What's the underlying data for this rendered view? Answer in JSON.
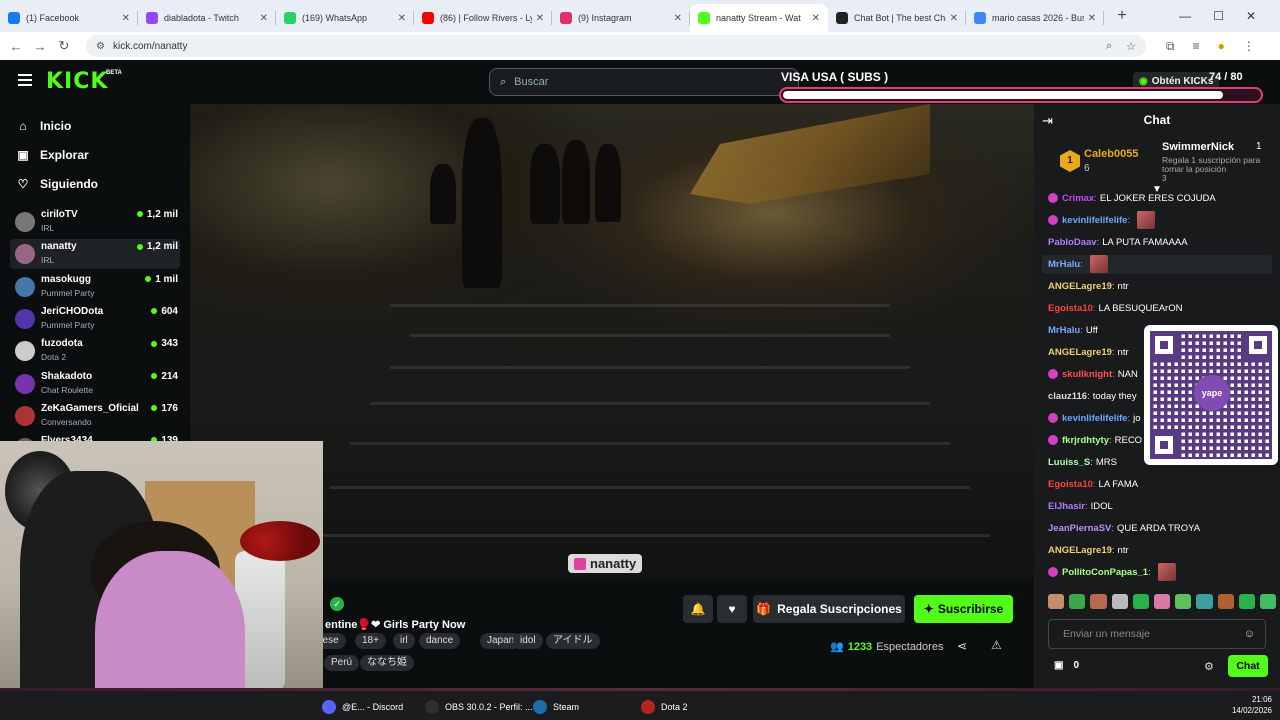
{
  "browser": {
    "tabs": [
      {
        "title": "(1) Facebook",
        "color": "#1877f2"
      },
      {
        "title": "diabladota - Twitch",
        "color": "#9146ff"
      },
      {
        "title": "(169) WhatsApp",
        "color": "#25d366"
      },
      {
        "title": "(86) | Follow Rivers - Lykk",
        "color": "#ff0000"
      },
      {
        "title": "(9) Instagram",
        "color": "#e1306c"
      },
      {
        "title": "nanatty Stream - Wat",
        "color": "#53fc18",
        "active": true
      },
      {
        "title": "Chat Bot | The best ChatB",
        "color": "#222222"
      },
      {
        "title": "mario casas 2026 - Busca",
        "color": "#4285f4"
      }
    ],
    "url": "kick.com/nanatty"
  },
  "header": {
    "logo": "KICK",
    "beta": "BETA",
    "search_placeholder": "Buscar",
    "kicks_label": "Obtén KICKs"
  },
  "overlay": {
    "title": "VISA USA ( SUBS )",
    "count": "74 / 80",
    "progress": 0.925
  },
  "sidebar": {
    "nav": [
      {
        "label": "Inicio",
        "icon": "home-icon"
      },
      {
        "label": "Explorar",
        "icon": "compass-icon"
      },
      {
        "label": "Siguiendo",
        "icon": "heart-icon"
      }
    ],
    "channels": [
      {
        "name": "ciriloTV",
        "category": "IRL",
        "viewers": "1,2 mil",
        "color": "#777"
      },
      {
        "name": "nanatty",
        "category": "IRL",
        "viewers": "1,2 mil",
        "color": "#996688"
      },
      {
        "name": "masokugg",
        "category": "Pummel Party",
        "viewers": "1 mil",
        "color": "#4477aa"
      },
      {
        "name": "JeriCHODota",
        "category": "Pummel Party",
        "viewers": "604",
        "color": "#5533aa"
      },
      {
        "name": "fuzodota",
        "category": "Dota 2",
        "viewers": "343",
        "color": "#ccc"
      },
      {
        "name": "Shakadoto",
        "category": "Chat Roulette",
        "viewers": "214",
        "color": "#7733aa"
      },
      {
        "name": "ZeKaGamers_Oficial",
        "category": "Conversando",
        "viewers": "176",
        "color": "#aa3333"
      },
      {
        "name": "Flyers3434",
        "category": "",
        "viewers": "139",
        "color": "#666"
      }
    ]
  },
  "video": {
    "watermark": "nanatty"
  },
  "stream": {
    "title": "entine🥊❤ Girls Party Now",
    "tags": [
      "nese",
      "18+",
      "irl",
      "dance",
      "Japan",
      "idol",
      "アイドル",
      "Perú",
      "ななち姫"
    ],
    "gift_label": "Regala Suscripciones",
    "subscribe_label": "Suscribirse",
    "viewers_count": "1233",
    "viewers_label": "Espectadores"
  },
  "chat": {
    "title": "Chat",
    "pinned": {
      "user1": "Caleb0055",
      "user1_rank": "1",
      "user1_num": "6",
      "user2": "SwimmerNick",
      "user2_count": "1",
      "user2_text": "Regala 1 suscripción para tomar la posición",
      "user2_num": "3"
    },
    "messages": [
      {
        "user": "Crimax",
        "text": "EL JOKER ERES COJUDA",
        "color": "#c04bf0",
        "badge": true
      },
      {
        "user": "kevinlifelifelife",
        "text": "",
        "color": "#6aa8ff",
        "badge": true,
        "emote": true
      },
      {
        "user": "PabloDaav",
        "text": "LA PUTA FAMAAAA",
        "color": "#b27cff",
        "badge": false
      },
      {
        "user": "MrHalu",
        "text": "",
        "color": "#7ea8ff",
        "badge": false,
        "emote": true
      },
      {
        "user": "ANGELagre19",
        "text": "ntr",
        "color": "#f0d070",
        "badge": false
      },
      {
        "user": "Egoista10",
        "text": "LA BESUQUEArON",
        "color": "#ff4040",
        "badge": false
      },
      {
        "user": "MrHalu",
        "text": "Uff",
        "color": "#7ea8ff",
        "badge": false
      },
      {
        "user": "ANGELagre19",
        "text": "ntr",
        "color": "#f0d070",
        "badge": false
      },
      {
        "user": "skullknight",
        "text": "NAN",
        "color": "#ff5050",
        "badge": true
      },
      {
        "user": "clauz116",
        "text": "today they",
        "color": "#dddddd",
        "badge": false
      },
      {
        "user": "kevinlifelifelife",
        "text": "jo",
        "color": "#6aa8ff",
        "badge": true
      },
      {
        "user": "fkrjrdhtyty",
        "text": "RECO",
        "color": "#aaff88",
        "badge": true
      },
      {
        "user": "Luuiss_S",
        "text": "MRS",
        "color": "#aaffaa",
        "badge": false
      },
      {
        "user": "Egoista10",
        "text": "LA FAMA",
        "color": "#ff4040",
        "badge": false
      },
      {
        "user": "ElJhasir",
        "text": "IDOL",
        "color": "#b27cff",
        "badge": false
      },
      {
        "user": "JeanPiernaSV",
        "text": "QUE ARDA TROYA",
        "color": "#c08cff",
        "badge": false
      },
      {
        "user": "ANGELagre19",
        "text": "ntr",
        "color": "#f0d070",
        "badge": false
      },
      {
        "user": "PollitoConPapas_1",
        "text": "",
        "color": "#aaff88",
        "badge": true,
        "emote": true
      }
    ],
    "qr_label": "yape",
    "input_placeholder": "Enviar un mensaje",
    "points": "0",
    "send_label": "Chat"
  },
  "taskbar": {
    "items": [
      {
        "label": "@E... - Discord",
        "color": "#5865f2"
      },
      {
        "label": "OBS 30.0.2 - Perfil: ...",
        "color": "#302e31"
      },
      {
        "label": "Steam",
        "color": "#1b6ea8"
      },
      {
        "label": "Dota 2",
        "color": "#b1261c"
      }
    ],
    "time": "21:06",
    "date": "14/02/2026"
  }
}
